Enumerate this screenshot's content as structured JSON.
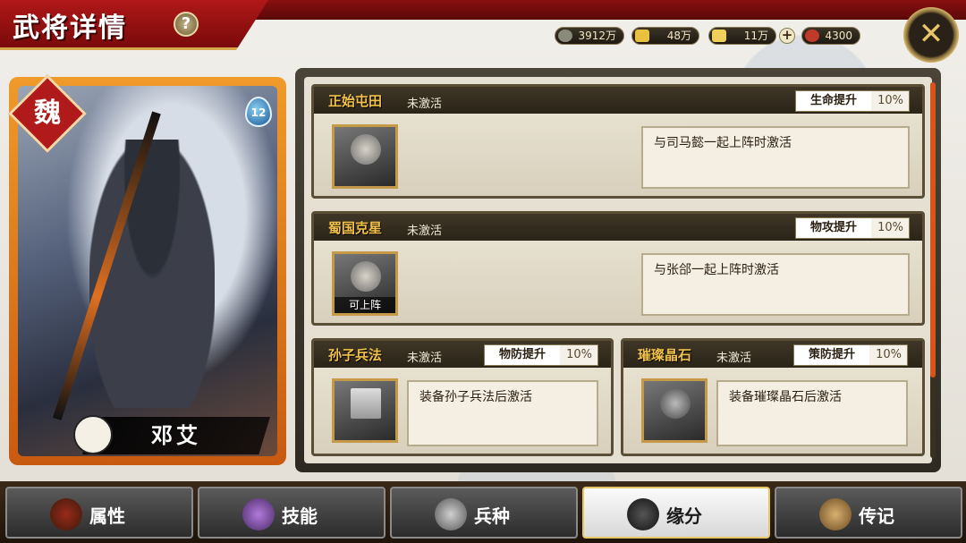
{
  "header": {
    "title": "武将详情",
    "help_label": "?",
    "close_label": "✕"
  },
  "currency": [
    {
      "icon": "coin-icon",
      "value": "3912万",
      "color": "#8a8a7a"
    },
    {
      "icon": "gold-ingot-icon",
      "value": "48万",
      "color": "#e9c040"
    },
    {
      "icon": "yuanbao-icon",
      "value": "11万",
      "color": "#f0d05a"
    },
    {
      "icon": "gem-icon",
      "value": "4300",
      "color": "#c03a2a"
    }
  ],
  "currency_plus": "+",
  "hero": {
    "kingdom": "魏",
    "level": "12",
    "name": "邓艾"
  },
  "fates": [
    {
      "name": "正始屯田",
      "status": "未激活",
      "bonus_label": "生命提升",
      "bonus_value": "10%",
      "condition": "与司马懿一起上阵时激活",
      "portrait_tag": ""
    },
    {
      "name": "蜀国克星",
      "status": "未激活",
      "bonus_label": "物攻提升",
      "bonus_value": "10%",
      "condition": "与张郃一起上阵时激活",
      "portrait_tag": "可上阵"
    },
    {
      "name": "孙子兵法",
      "status": "未激活",
      "bonus_label": "物防提升",
      "bonus_value": "10%",
      "condition": "装备孙子兵法后激活",
      "portrait_tag": ""
    },
    {
      "name": "璀璨晶石",
      "status": "未激活",
      "bonus_label": "策防提升",
      "bonus_value": "10%",
      "condition": "装备璀璨晶石后激活",
      "portrait_tag": ""
    }
  ],
  "tabs": [
    {
      "label": "属性",
      "icon": "helmet-icon",
      "active": false
    },
    {
      "label": "技能",
      "icon": "skill-scroll-icon",
      "active": false
    },
    {
      "label": "兵种",
      "icon": "tiger-icon",
      "active": false
    },
    {
      "label": "缘分",
      "icon": "handshake-icon",
      "active": true
    },
    {
      "label": "传记",
      "icon": "bamboo-scroll-icon",
      "active": false
    }
  ]
}
